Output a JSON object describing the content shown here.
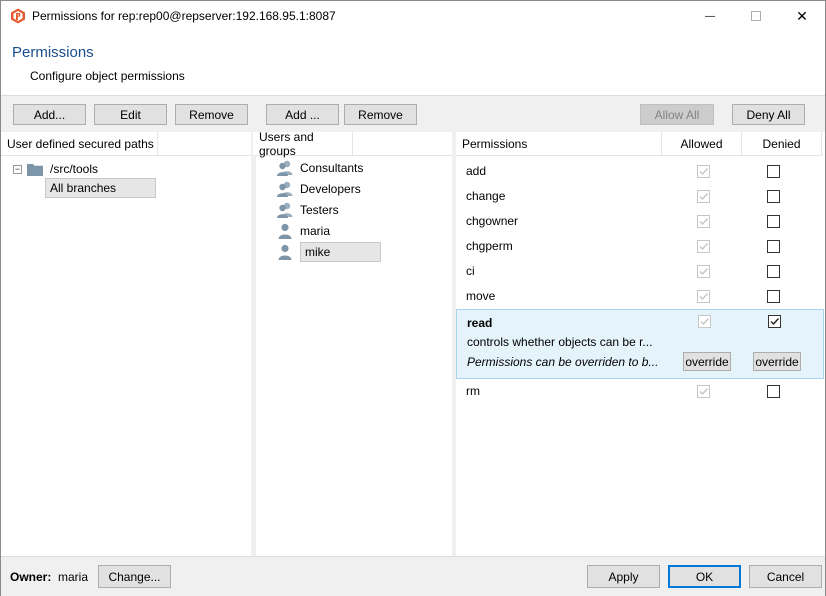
{
  "window": {
    "title": "Permissions for rep:rep00@repserver:192.168.95.1:8087",
    "minimize_glyph": "—",
    "close_glyph": "✕"
  },
  "header": {
    "title": "Permissions",
    "subtitle": "Configure object permissions"
  },
  "paths_pane": {
    "add_label": "Add...",
    "edit_label": "Edit",
    "remove_label": "Remove",
    "column_header": "User defined secured paths",
    "tree": {
      "expander": "−",
      "folder_label": "/src/tools",
      "child_label": "All branches"
    }
  },
  "users_pane": {
    "add_label": "Add ...",
    "remove_label": "Remove",
    "column_header": "Users and groups",
    "items": [
      {
        "label": "Consultants",
        "type": "group"
      },
      {
        "label": "Developers",
        "type": "group"
      },
      {
        "label": "Testers",
        "type": "group"
      },
      {
        "label": "maria",
        "type": "user"
      },
      {
        "label": "mike",
        "type": "user",
        "selected": true
      }
    ]
  },
  "permissions_pane": {
    "allow_all_label": "Allow All",
    "deny_all_label": "Deny All",
    "headers": {
      "permissions": "Permissions",
      "allowed": "Allowed",
      "denied": "Denied"
    },
    "rows": [
      {
        "name": "add",
        "allowed": true,
        "denied": false
      },
      {
        "name": "change",
        "allowed": true,
        "denied": false
      },
      {
        "name": "chgowner",
        "allowed": true,
        "denied": false
      },
      {
        "name": "chgperm",
        "allowed": true,
        "denied": false
      },
      {
        "name": "ci",
        "allowed": true,
        "denied": false
      },
      {
        "name": "move",
        "allowed": true,
        "denied": false
      }
    ],
    "expanded_row": {
      "name": "read",
      "description": "controls whether objects can be r...",
      "override_note": "Permissions can be overriden to b...",
      "allowed": true,
      "denied": true,
      "override_allowed_label": "override",
      "override_denied_label": "override"
    },
    "last_row": {
      "name": "rm",
      "allowed": true,
      "denied": false
    }
  },
  "footer": {
    "owner_label": "Owner:",
    "owner_value": "maria",
    "change_label": "Change...",
    "apply_label": "Apply",
    "ok_label": "OK",
    "cancel_label": "Cancel"
  },
  "colors": {
    "accent": "#0078d7",
    "title_blue": "#1a4d8c",
    "app_icon": "#e65c2e",
    "icon_gray": "#7d95a8"
  }
}
